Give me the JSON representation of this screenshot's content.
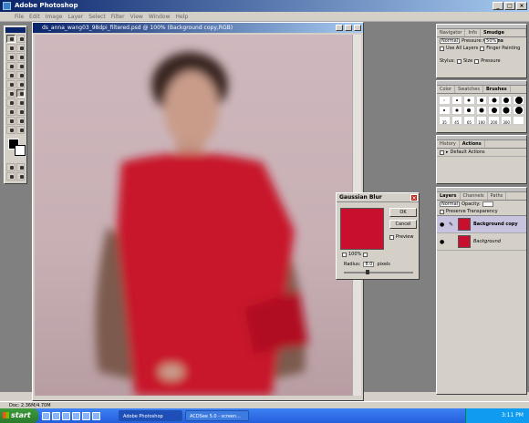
{
  "app": {
    "title": "Adobe Photoshop"
  },
  "menu": [
    "File",
    "Edit",
    "Image",
    "Layer",
    "Select",
    "Filter",
    "View",
    "Window",
    "Help"
  ],
  "document": {
    "title": "ds_anna_wang03_98dpi_filtered.psd @ 100% (Background copy,RGB)"
  },
  "status": {
    "doc_size": "Doc: 2.36M/4.70M"
  },
  "options_panel": {
    "tabs": [
      "Navigator",
      "Info",
      "Smudge Options"
    ],
    "mode": "Normal",
    "pressure_label": "Pressure:",
    "pressure_value": "50%",
    "use_all_layers": "Use All Layers",
    "finger_painting": "Finger Painting",
    "stylus_label": "Stylus:",
    "stylus_size": "Size",
    "stylus_pressure": "Pressure"
  },
  "brushes_panel": {
    "tabs": [
      "Color",
      "Swatches",
      "Brushes"
    ],
    "labels": [
      "35",
      "45",
      "65",
      "100",
      "200",
      "300"
    ]
  },
  "actions_panel": {
    "tabs": [
      "History",
      "Actions"
    ],
    "item": "Default Actions"
  },
  "layers_panel": {
    "tabs": [
      "Layers",
      "Channels",
      "Paths"
    ],
    "mode": "Normal",
    "opacity_label": "Opacity:",
    "preserve": "Preserve Transparency",
    "layers": [
      {
        "name": "Background copy"
      },
      {
        "name": "Background"
      }
    ]
  },
  "gaussian_blur": {
    "title": "Gaussian Blur",
    "ok": "OK",
    "cancel": "Cancel",
    "preview": "Preview",
    "zoom": "100%",
    "radius_label": "Radius:",
    "radius_value": "8.0",
    "unit": "pixels"
  },
  "taskbar": {
    "start": "start",
    "tasks": [
      "Adobe Photoshop",
      "ACDSee 5.0 - screen..."
    ],
    "clock": "3:11 PM"
  }
}
